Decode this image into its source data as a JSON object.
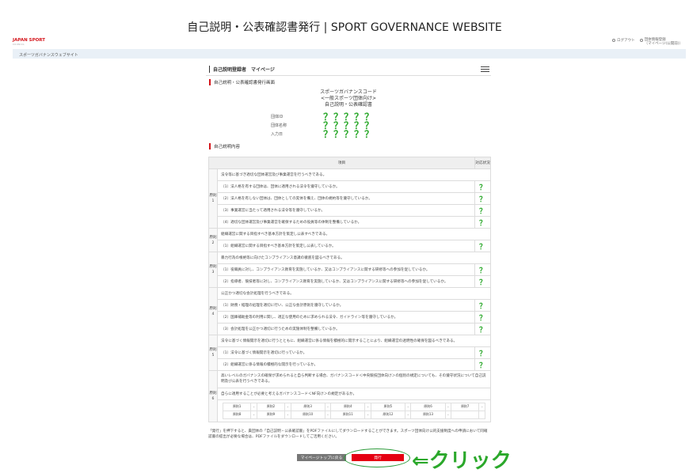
{
  "banner_title": "自己説明・公表確認書発行 | SPORT GOVERNANCE WEBSITE",
  "header": {
    "logo_text": "JAPAN SPORT",
    "logo_sub": "COUNCIL",
    "logout": "ログアウト",
    "org_link_1": "団体情報登録",
    "org_link_2": "（マイページ(公開前)）"
  },
  "subbar": "スポーツガバナンスウェブサイト",
  "page_title": "自己説明登録者　マイページ",
  "section_issue": "自己説明・公表確認書発行画面",
  "cert": {
    "line1": "スポーツガバナンスコード",
    "line2": "<一般スポーツ団体向け>",
    "line3": "自己説明・公表確認書"
  },
  "info": [
    {
      "label": "団体ID",
      "value": "？？？？？"
    },
    {
      "label": "団体名称",
      "value": "？？？？？"
    },
    {
      "label": "入力日",
      "value": "？？？？？"
    }
  ],
  "section_content": "自己説明内容",
  "table": {
    "col_item": "項目",
    "col_status": "対応状況",
    "status_mark": "？",
    "principles": [
      {
        "label": "原則1",
        "text": "法令等に基づき適切な団体運営及び事業運営を行うべきである。",
        "items": [
          "（1）法人格を有する団体は、団体に適用される法令を遵守しているか。",
          "（2）法人格を有しない団体は、団体としての実体を備え、団体の規約等を遵守しているか。",
          "（3）事業運営に当たって適用される法令等を遵守しているか。",
          "（4）適切な団体運営及び事業運営を確保するための役員等の体制を整備しているか。"
        ]
      },
      {
        "label": "原則2",
        "text": "組織運営に関する目指すべき基本方針を策定し公表すべきである。",
        "items": [
          "（1）組織運営に関する目指すべき基本方針を策定し公表しているか。"
        ]
      },
      {
        "label": "原則3",
        "text": "暴力行為の根絶等に向けたコンプライアンス意識の徹底を図るべきである。",
        "items": [
          "（1）役職員に対し、コンプライアンス教育を実施しているか、又はコンプライアンスに関する研修等への参加を促しているか。",
          "（2）指導者、競技者等に対し、コンプライアンス教育を実施しているか、又はコンプライアンスに関する研修等への参加を促しているか。"
        ]
      },
      {
        "label": "原則4",
        "text": "公正かつ適切な会計処理を行うべきである。",
        "items": [
          "（1）財務・経理の処理を適切に行い、公正な会計原則を遵守しているか。",
          "（2）国庫補助金等の利用に関し、適正な使用のために求められる法令、ガイドライン等を遵守しているか。",
          "（3）会計処理を公正かつ適切に行うための実施体制を整備しているか。"
        ]
      },
      {
        "label": "原則5",
        "text": "法令に基づく情報開示を適切に行うとともに、組織運営に係る情報を積極的に開示することにより、組織運営の透明性の確保を図るべきである。",
        "items": [
          "（1）法令に基づく情報開示を適切に行っているか。",
          "（2）組織運営に係る情報の積極的な開示を行っているか。"
        ]
      },
      {
        "label": "原則6",
        "text": "高いレベルのガバナンスの確保が求められると自ら判断する場合、ガバナンスコード＜中央競技団体向け＞の個別の規定についても、その遵守状況について自己説明及び公表を行うべきである。",
        "text2": "自らに適用することが必要と考えるガバナンスコード＜NF向け＞の規定があるか。",
        "sub_rows": [
          [
            "原則1",
            "-",
            "原則2",
            "-",
            "原則3",
            "-",
            "原則4",
            "-",
            "原則5",
            "-",
            "原則6",
            "-",
            "原則7",
            "-"
          ],
          [
            "原則8",
            "-",
            "原則9",
            "-",
            "原則10",
            "-",
            "原則11",
            "-",
            "原則12",
            "-",
            "原則13",
            "-",
            "",
            ""
          ]
        ]
      }
    ]
  },
  "note": "「発行」を押下すると、貴団体の「自己説明・公表確認書」をPDFファイルにしてダウンロードすることができます。スポーツ団体向け公的支援制度への申請において同確認書の提出が必要な場合は、PDFファイルをダウンロードしてご活用ください。",
  "buttons": {
    "back": "マイページトップに戻る",
    "issue": "発行"
  },
  "annotation": "⇐クリック",
  "colors": {
    "accent_red": "#e50012",
    "check_green": "#2ba82b"
  }
}
